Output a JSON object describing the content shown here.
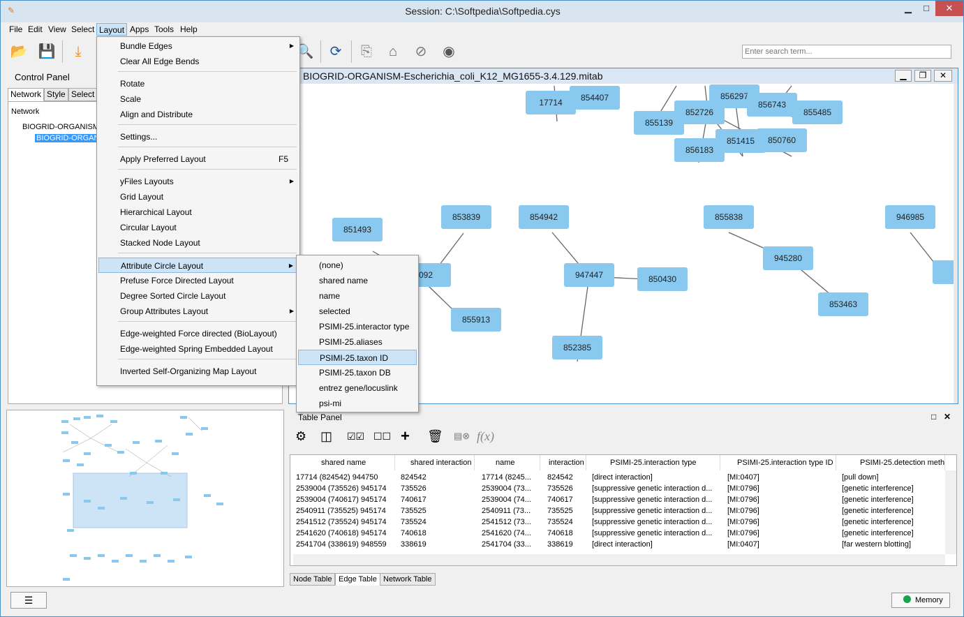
{
  "window": {
    "title": "Session: C:\\Softpedia\\Softpedia.cys"
  },
  "menubar": {
    "items": [
      "File",
      "Edit",
      "View",
      "Select",
      "Layout",
      "Apps",
      "Tools",
      "Help"
    ]
  },
  "toolbar": {
    "search_placeholder": "Enter search term..."
  },
  "control_panel": {
    "title": "Control Panel",
    "tabs": [
      "Network",
      "Style",
      "Select"
    ],
    "tree_header": "Network",
    "tree_root": "BIOGRID-ORGANISM-",
    "tree_child": "BIOGRID-ORGANI"
  },
  "layout_menu": {
    "items": [
      {
        "label": "Bundle Edges",
        "submenu": true
      },
      {
        "label": "Clear All Edge Bends"
      },
      {
        "label": "Rotate"
      },
      {
        "label": "Scale"
      },
      {
        "label": "Align and Distribute"
      },
      {
        "label": "Settings..."
      },
      {
        "label": "Apply Preferred Layout",
        "shortcut": "F5"
      },
      {
        "label": "yFiles Layouts",
        "submenu": true
      },
      {
        "label": "Grid Layout"
      },
      {
        "label": "Hierarchical Layout"
      },
      {
        "label": "Circular Layout"
      },
      {
        "label": "Stacked Node Layout"
      },
      {
        "label": "Attribute Circle Layout",
        "submenu": true,
        "highlighted": true
      },
      {
        "label": "Prefuse Force Directed Layout"
      },
      {
        "label": "Degree Sorted Circle Layout"
      },
      {
        "label": "Group Attributes Layout",
        "submenu": true
      },
      {
        "label": "Edge-weighted Force directed (BioLayout)"
      },
      {
        "label": "Edge-weighted Spring Embedded Layout"
      },
      {
        "label": "Inverted Self-Organizing Map Layout"
      }
    ]
  },
  "attribute_submenu": {
    "items": [
      "(none)",
      "shared name",
      "name",
      "selected",
      "PSIMI-25.interactor type",
      "PSIMI-25.aliases",
      "PSIMI-25.taxon ID",
      "PSIMI-25.taxon DB",
      "entrez gene/locuslink",
      "psi-mi"
    ],
    "highlighted": "PSIMI-25.taxon ID"
  },
  "network_view": {
    "title": "BIOGRID-ORGANISM-Escherichia_coli_K12_MG1655-3.4.129.mitab",
    "nodes": [
      "854407",
      "17714",
      "856297",
      "856743",
      "855485",
      "852726",
      "855139",
      "856183",
      "851415",
      "850760",
      "851493",
      "853839",
      "854942",
      "855838",
      "946985",
      "945280",
      "947447",
      "850430",
      "855913",
      "853463",
      "852385",
      "092",
      "94"
    ]
  },
  "table_panel": {
    "title": "Table Panel",
    "columns": [
      "shared name",
      "shared interaction",
      "name",
      "interaction",
      "PSIMI-25.interaction type",
      "PSIMI-25.interaction type ID",
      "PSIMI-25.detection meth"
    ],
    "rows": [
      [
        "17714 (824542) 944750",
        "824542",
        "17714 (8245...",
        "824542",
        "[direct interaction]",
        "[MI:0407]",
        "[pull down]"
      ],
      [
        "2539004 (735526) 945174",
        "735526",
        "2539004 (73...",
        "735526",
        "[suppressive genetic interaction d...",
        "[MI:0796]",
        "[genetic interference]"
      ],
      [
        "2539004 (740617) 945174",
        "740617",
        "2539004 (74...",
        "740617",
        "[suppressive genetic interaction d...",
        "[MI:0796]",
        "[genetic interference]"
      ],
      [
        "2540911 (735525) 945174",
        "735525",
        "2540911 (73...",
        "735525",
        "[suppressive genetic interaction d...",
        "[MI:0796]",
        "[genetic interference]"
      ],
      [
        "2541512 (735524) 945174",
        "735524",
        "2541512 (73...",
        "735524",
        "[suppressive genetic interaction d...",
        "[MI:0796]",
        "[genetic interference]"
      ],
      [
        "2541620 (740618) 945174",
        "740618",
        "2541620 (74...",
        "740618",
        "[suppressive genetic interaction d...",
        "[MI:0796]",
        "[genetic interference]"
      ],
      [
        "2541704 (338619) 948559",
        "338619",
        "2541704 (33...",
        "338619",
        "[direct interaction]",
        "[MI:0407]",
        "[far western blotting]"
      ]
    ],
    "tabs": [
      "Node Table",
      "Edge Table",
      "Network Table"
    ]
  },
  "statusbar": {
    "memory_label": "Memory"
  },
  "colors": {
    "node_fill": "#89c9ef",
    "menu_highlight": "#cde4f7",
    "memory_ok": "#1aa34a"
  }
}
